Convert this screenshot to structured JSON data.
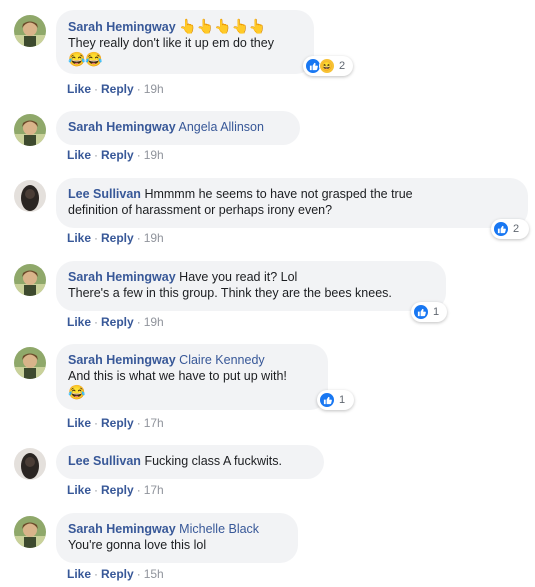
{
  "comments": [
    {
      "author": "Sarah Hemingway",
      "tag": "",
      "text": "They really don't like it up em do they",
      "emoji_inline": "👆👆👆👆👆",
      "emoji_line": "😂😂",
      "reaction_count": "2",
      "reactions": [
        "like-icon",
        "haha-icon"
      ],
      "like_label": "Like",
      "reply_label": "Reply",
      "time": "19h",
      "avatar": "avatar-sarah"
    },
    {
      "author": "Sarah Hemingway",
      "tag": "Angela Allinson",
      "text": "",
      "like_label": "Like",
      "reply_label": "Reply",
      "time": "19h",
      "avatar": "avatar-sarah"
    },
    {
      "author": "Lee Sullivan",
      "tag": "",
      "text_line1": "Hmmmm he seems to have not grasped the true",
      "text_line2": "definition of harassment or perhaps irony even?",
      "reaction_count": "2",
      "reactions": [
        "like-icon"
      ],
      "like_label": "Like",
      "reply_label": "Reply",
      "time": "19h",
      "avatar": "avatar-lee"
    },
    {
      "author": "Sarah Hemingway",
      "tag": "",
      "text_line1": "Have you read it? Lol",
      "text_line2": "There's a few in this group. Think they are the bees knees.",
      "reaction_count": "1",
      "reactions": [
        "like-icon"
      ],
      "like_label": "Like",
      "reply_label": "Reply",
      "time": "19h",
      "avatar": "avatar-sarah"
    },
    {
      "author": "Sarah Hemingway",
      "tag": "Claire Kennedy",
      "text": "And this is what we have to put up with!",
      "emoji_line": "😂",
      "reaction_count": "1",
      "reactions": [
        "like-icon"
      ],
      "like_label": "Like",
      "reply_label": "Reply",
      "time": "17h",
      "avatar": "avatar-sarah"
    },
    {
      "author": "Lee Sullivan",
      "tag": "",
      "text": "Fucking class A fuckwits.",
      "like_label": "Like",
      "reply_label": "Reply",
      "time": "17h",
      "avatar": "avatar-lee"
    },
    {
      "author": "Sarah Hemingway",
      "tag": "Michelle Black",
      "text": "You're gonna love this lol",
      "like_label": "Like",
      "reply_label": "Reply",
      "time": "15h",
      "avatar": "avatar-sarah"
    }
  ],
  "colors": {
    "author": "#385898",
    "bubble": "#f2f3f5",
    "meta": "#90949c",
    "like_blue": "#1877f2"
  }
}
